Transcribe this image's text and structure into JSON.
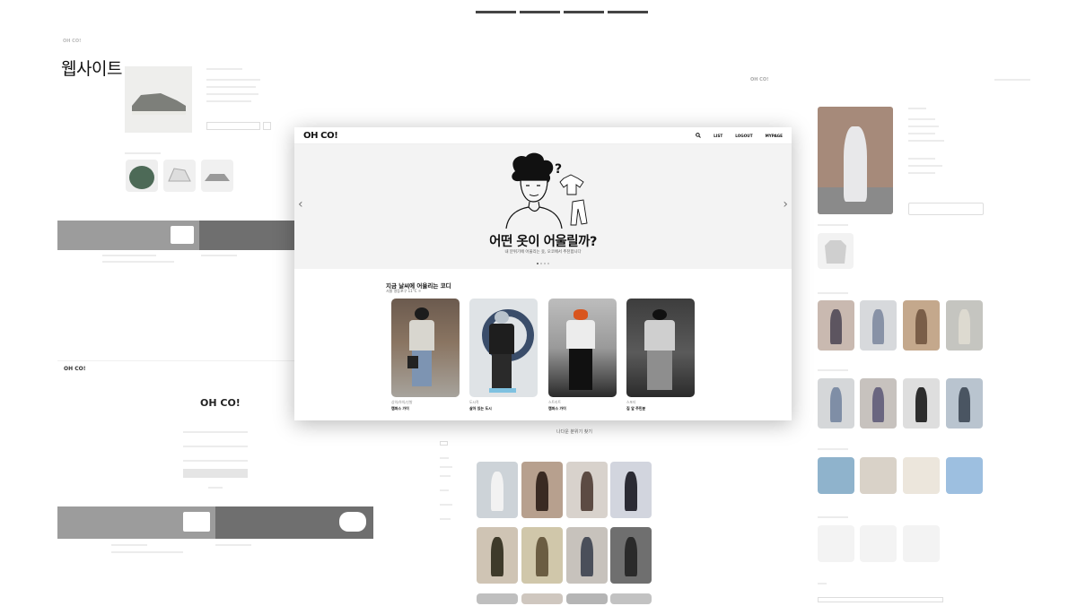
{
  "page_label": "웹사이트",
  "brand": "OH CO!",
  "nav": {
    "list": "LIST",
    "logout": "LOGOUT",
    "mypage": "MYPAGE"
  },
  "icons": {
    "search": "search-icon",
    "prev": "chevron-left-icon",
    "next": "chevron-right-icon"
  },
  "hero": {
    "title": "어떤 옷이 어울릴까?",
    "subtitle": "내 분위기에 어울리는 옷, 오코에서 추천합니다",
    "slide_index": 1,
    "slide_count": 4
  },
  "section": {
    "title": "지금 날씨에 어울리는 코디",
    "subtitle": "서울 영등포구 11°C",
    "cards": [
      {
        "category": "상의/하의/신발",
        "name": "캠퍼스 가이"
      },
      {
        "category": "도시적",
        "name": "살아 있는 도시"
      },
      {
        "category": "스트리트",
        "name": "캠퍼스 가이"
      },
      {
        "category": "스포티",
        "name": "집 앞 주민분"
      }
    ]
  },
  "background": {
    "login_brand": "OH CO!",
    "community_heading": "나다운 분위기 찾기"
  },
  "colors": {
    "accent": "#111111",
    "hero_bg": "#f3f3f3",
    "banner_gray": "#8c8c8c"
  }
}
